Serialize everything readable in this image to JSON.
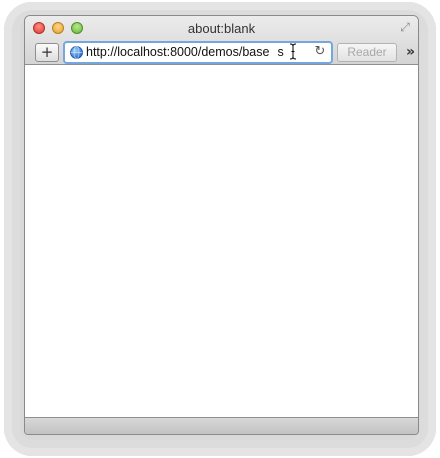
{
  "window": {
    "title": "about:blank"
  },
  "toolbar": {
    "add_label": "+",
    "url_value": "http://localhost:8000/demos/base",
    "url_tail": "s",
    "reader_label": "Reader",
    "overflow_label": "»",
    "reload_label": "↻",
    "fullscreen_label": "⤢"
  },
  "icons": {
    "site": "globe-icon",
    "reload": "reload-icon",
    "cursor": "text-cursor-icon",
    "fullscreen": "fullscreen-icon",
    "overflow": "chevron-double-right-icon"
  },
  "colors": {
    "close": "#dc3b32",
    "minimize": "#e0a12a",
    "maximize": "#66b33b",
    "focus_ring": "#74a6e0"
  }
}
